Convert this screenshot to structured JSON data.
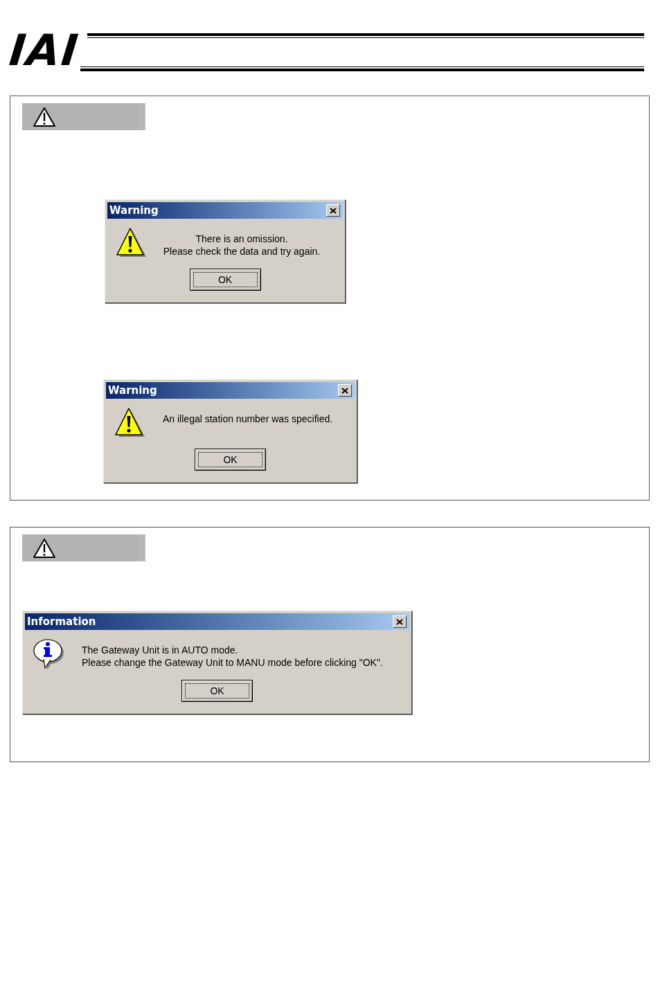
{
  "header": {
    "logo": "IAI"
  },
  "sections": [
    {
      "dialogs": [
        {
          "kind": "warning",
          "title": "Warning",
          "message": [
            "There is an omission.",
            "Please check the data and try again."
          ],
          "button": "OK"
        },
        {
          "kind": "warning",
          "title": "Warning",
          "message": [
            "An illegal station number was specified."
          ],
          "button": "OK"
        }
      ]
    },
    {
      "dialogs": [
        {
          "kind": "information",
          "title": "Information",
          "message": [
            "The Gateway Unit is in AUTO mode.",
            "Please change the Gateway Unit to MANU mode before clicking \"OK\"."
          ],
          "button": "OK"
        }
      ]
    }
  ]
}
